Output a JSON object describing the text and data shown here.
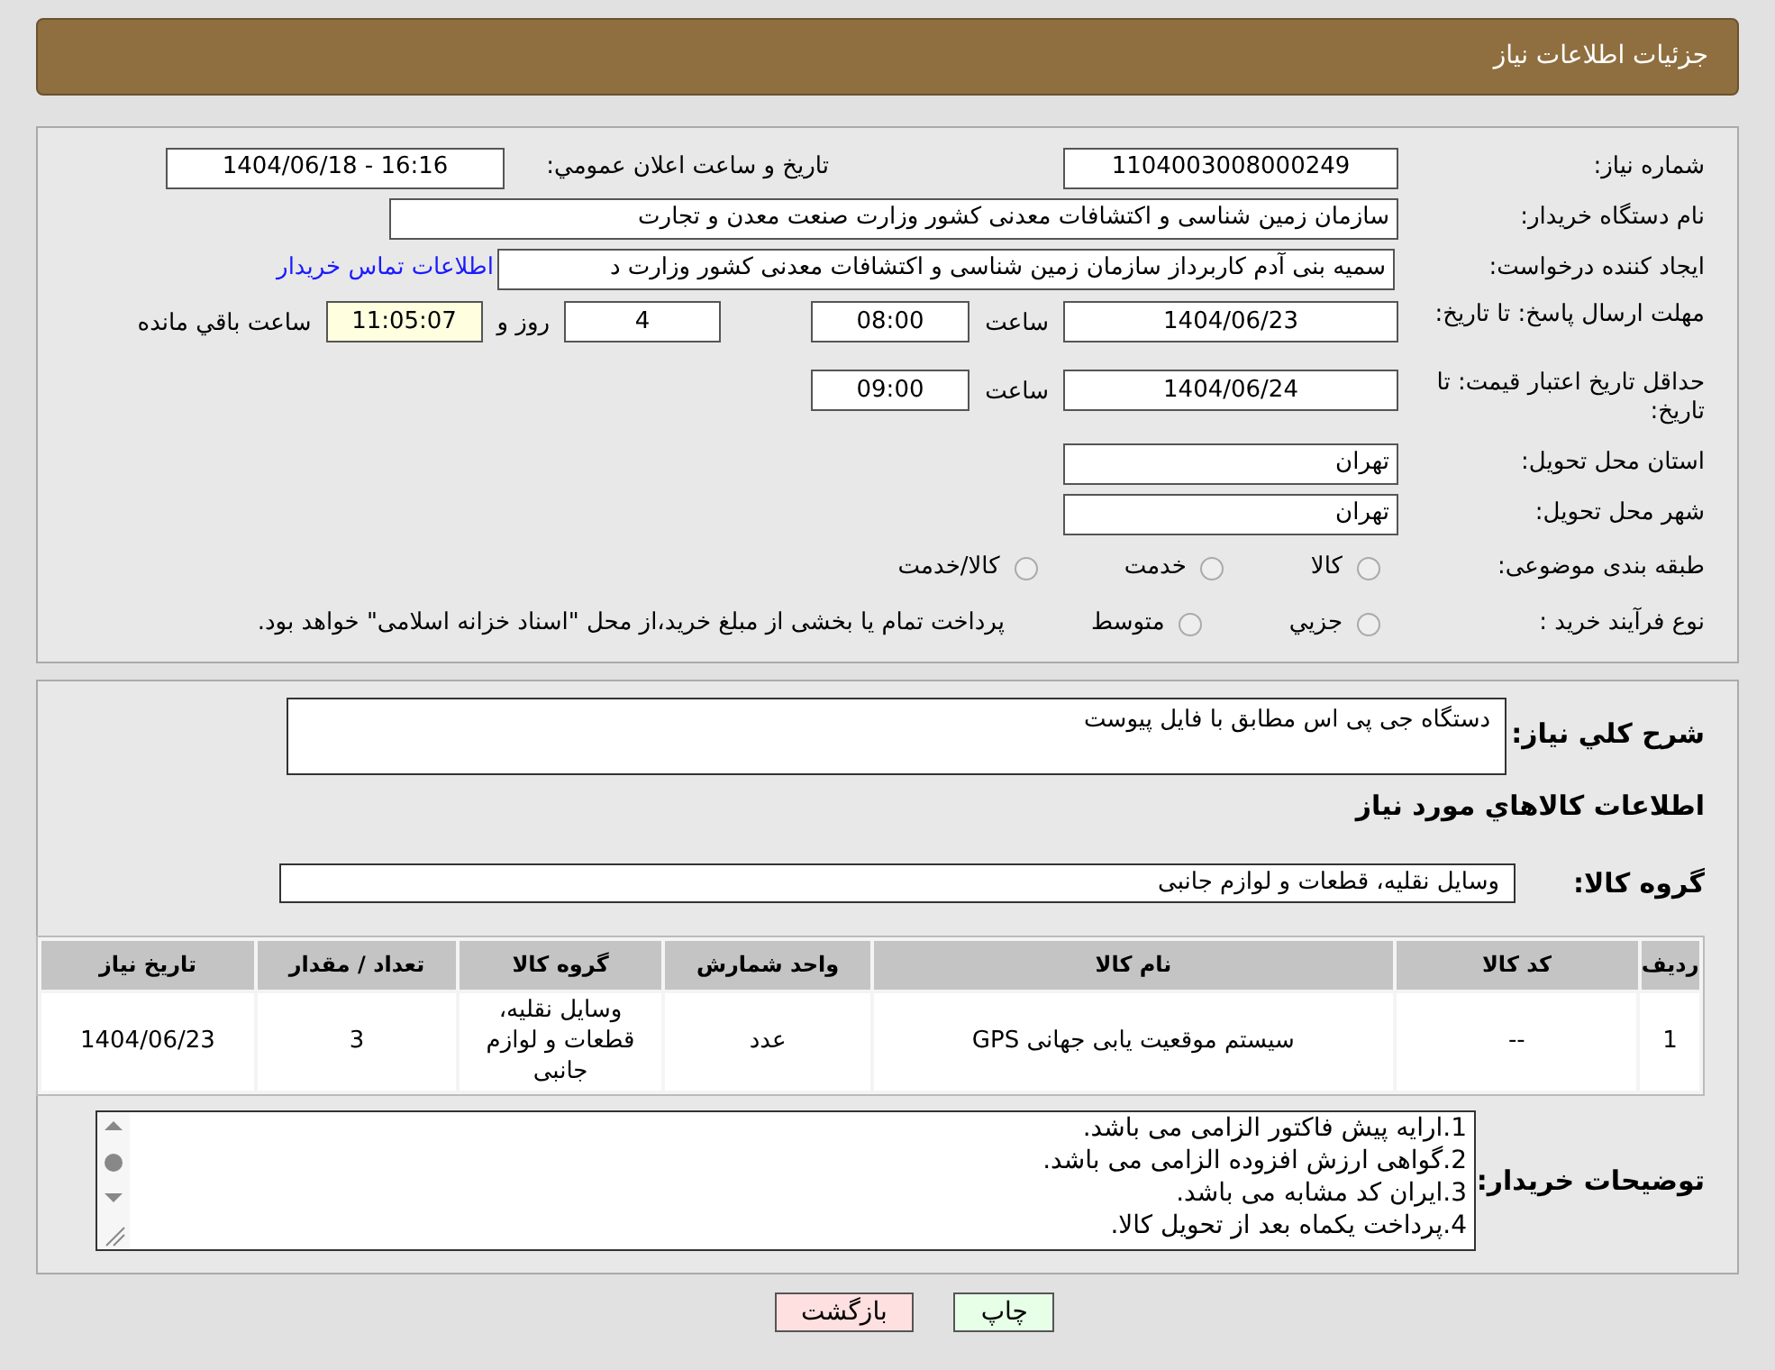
{
  "header": {
    "title": "جزئیات اطلاعات نیاز"
  },
  "need_number": {
    "label": "شماره نیاز:",
    "value": "1104003008000249"
  },
  "announce": {
    "label": "تاریخ و ساعت اعلان عمومي:",
    "value": "1404/06/18 - 16:16"
  },
  "buyer": {
    "label": "نام دستگاه خریدار:",
    "value": "سازمان زمین شناسی و اکتشافات معدنی کشور وزارت صنعت معدن و تجارت"
  },
  "creator": {
    "label": "ایجاد کننده درخواست:",
    "value": "سمیه بنی آدم کاربرداز سازمان زمین شناسی و اکتشافات معدنی کشور وزارت د",
    "link": "اطلاعات تماس خریدار"
  },
  "deadline": {
    "label": "مهلت ارسال پاسخ: تا تاریخ:",
    "date": "1404/06/23",
    "time_label": "ساعت",
    "time": "08:00",
    "days": "4",
    "days_label": "روز و",
    "remaining": "11:05:07",
    "remaining_label": "ساعت باقي مانده"
  },
  "validity": {
    "label": "حداقل تاریخ اعتبار قیمت: تا تاریخ:",
    "date": "1404/06/24",
    "time_label": "ساعت",
    "time": "09:00"
  },
  "province": {
    "label": "استان محل تحویل:",
    "value": "تهران"
  },
  "city": {
    "label": "شهر محل تحویل:",
    "value": "تهران"
  },
  "category": {
    "label": "طبقه بندی موضوعی:",
    "options": [
      {
        "label": "کالا",
        "selected": false
      },
      {
        "label": "خدمت",
        "selected": false
      },
      {
        "label": "کالا/خدمت",
        "selected": false
      }
    ]
  },
  "process": {
    "label": "نوع فرآیند خرید :",
    "options": [
      {
        "label": "جزيي",
        "selected": false
      },
      {
        "label": "متوسط",
        "selected": false
      }
    ],
    "note": "پرداخت تمام یا بخشی از مبلغ خرید،از محل \"اسناد خزانه اسلامی\" خواهد بود."
  },
  "description": {
    "label": "شرح کلي نیاز:",
    "value": "دستگاه جی پی اس مطابق با فایل پیوست"
  },
  "goods_heading": "اطلاعات کالاهاي مورد نیاز",
  "goods_group": {
    "label": "گروه کالا:",
    "value": "وسایل نقلیه، قطعات و لوازم جانبی"
  },
  "table": {
    "columns": [
      "ردیف",
      "کد کالا",
      "نام کالا",
      "واحد شمارش",
      "گروه کالا",
      "تعداد / مقدار",
      "تاریخ نیاز"
    ],
    "rows": [
      [
        "1",
        "--",
        "سیستم موقعیت یابی جهانی GPS",
        "عدد",
        "وسایل نقلیه، قطعات و لوازم جانبی",
        "3",
        "1404/06/23"
      ]
    ]
  },
  "notes": {
    "label": "توضیحات خریدار:",
    "lines": [
      "1.ارایه پیش فاکتور الزامی می باشد.",
      "2.گواهی ارزش افزوده الزامی می باشد.",
      "3.ایران کد مشابه می باشد.",
      "4.پرداخت یکماه بعد از تحویل کالا."
    ]
  },
  "buttons": [
    {
      "label": "چاپ",
      "kind": "print"
    },
    {
      "label": "بازگشت",
      "kind": "back"
    }
  ]
}
